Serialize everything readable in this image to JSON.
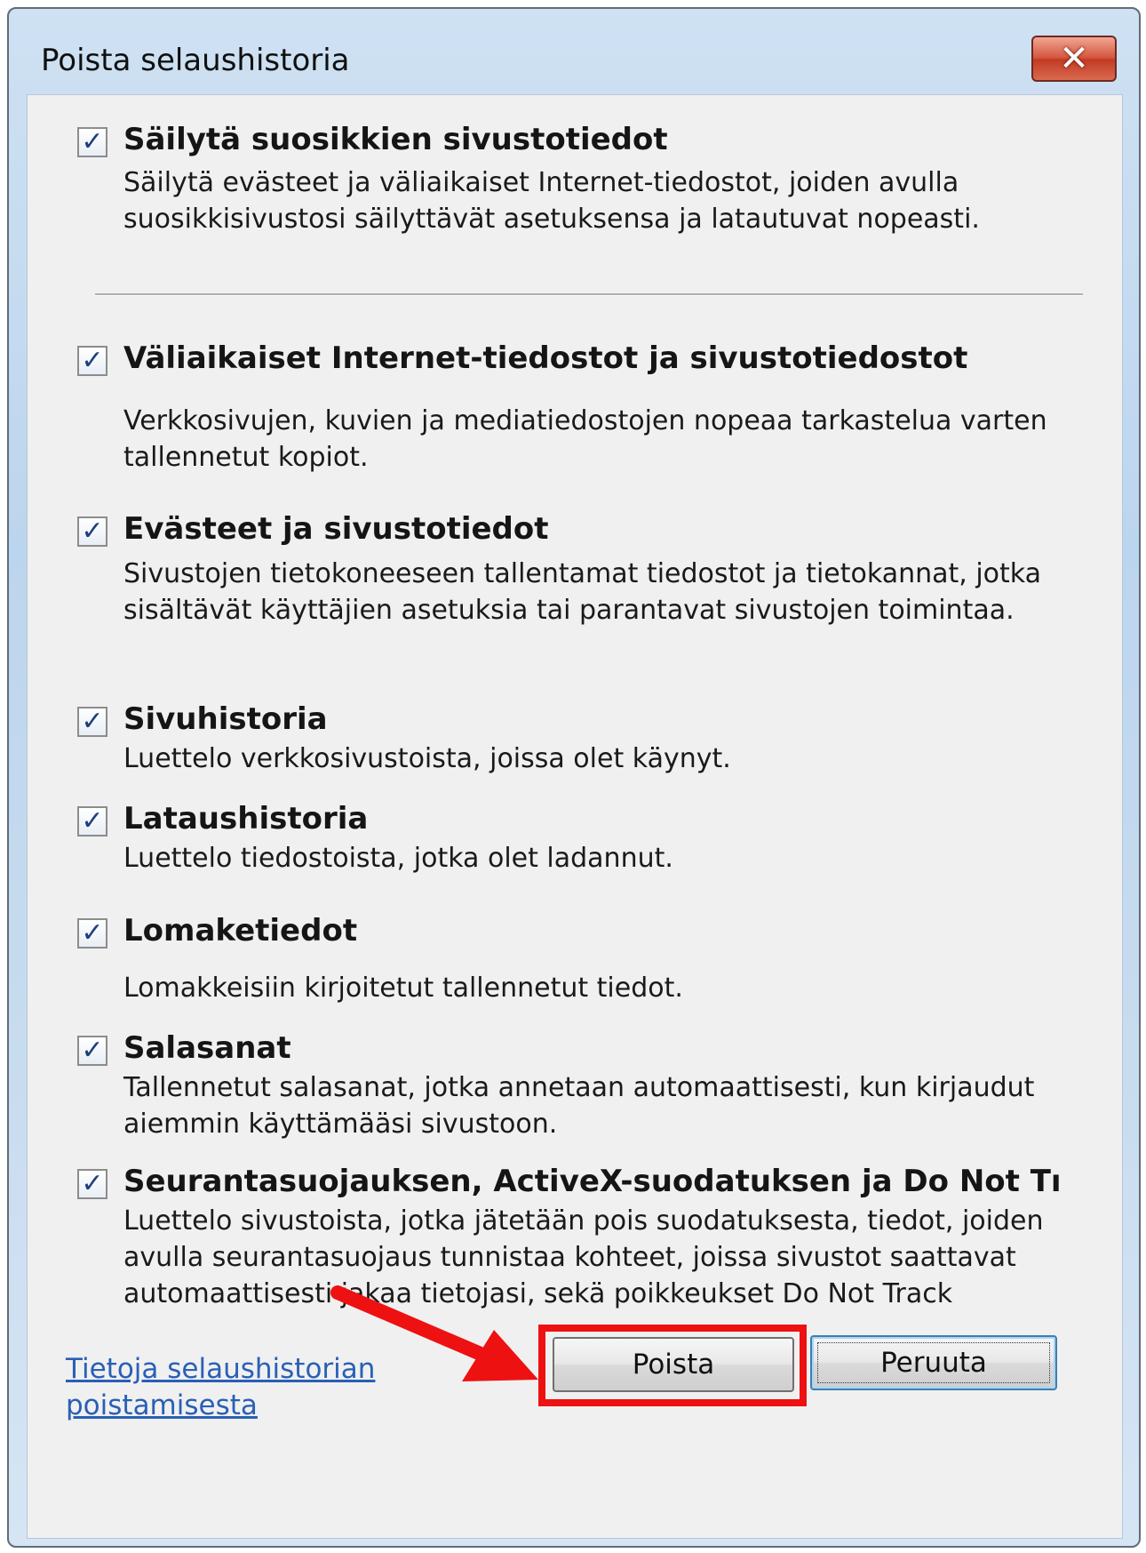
{
  "window": {
    "title": "Poista selaushistoria",
    "close_label": "✕"
  },
  "options": [
    {
      "label": "Säilytä suosikkien sivustotiedot",
      "checked": true,
      "description": "Säilytä evästeet ja väliaikaiset Internet-tiedostot, joiden avulla suosikkisivustosi säilyttävät asetuksensa ja latautuvat nopeasti."
    },
    {
      "label": "Väliaikaiset Internet-tiedostot ja sivustotiedostot",
      "checked": true,
      "description": "Verkkosivujen, kuvien ja mediatiedostojen nopeaa tarkastelua varten tallennetut kopiot."
    },
    {
      "label": "Evästeet ja sivustotiedot",
      "checked": true,
      "description": "Sivustojen tietokoneeseen tallentamat tiedostot ja tietokannat, jotka sisältävät käyttäjien asetuksia tai parantavat sivustojen toimintaa."
    },
    {
      "label": "Sivuhistoria",
      "checked": true,
      "description": "Luettelo verkkosivustoista, joissa olet käynyt."
    },
    {
      "label": "Lataushistoria",
      "checked": true,
      "description": "Luettelo tiedostoista, jotka olet ladannut."
    },
    {
      "label": "Lomaketiedot",
      "checked": true,
      "description": "Lomakkeisiin kirjoitetut tallennetut tiedot."
    },
    {
      "label": "Salasanat",
      "checked": true,
      "description": "Tallennetut salasanat, jotka annetaan automaattisesti, kun kirjaudut aiemmin käyttämääsi sivustoon."
    },
    {
      "label": "Seurantasuojauksen, ActiveX-suodatuksen ja Do Not Tı",
      "checked": true,
      "description": "Luettelo sivustoista, jotka jätetään pois suodatuksesta, tiedot, joiden avulla seurantasuojaus tunnistaa kohteet, joissa sivustot saattavat automaattisesti jakaa tietojasi, sekä poikkeukset Do Not Track"
    }
  ],
  "footer": {
    "link_text": "Tietoja selaushistorian poistamisesta",
    "delete_button": "Poista",
    "cancel_button": "Peruuta"
  },
  "colors": {
    "highlight": "#ee1111",
    "link": "#2a5fb6"
  },
  "icons": {
    "checkbox_checked": "✓",
    "annotation": "red-arrow-icon"
  }
}
